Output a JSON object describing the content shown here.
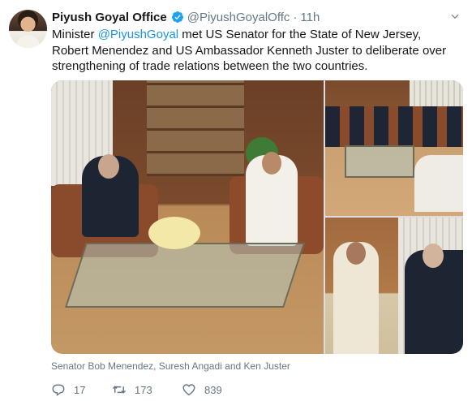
{
  "tweet": {
    "author_name": "Piyush Goyal Office",
    "handle": "@PiyushGoyalOffc",
    "separator": "·",
    "time": "11h",
    "text_before": "Minister ",
    "mention": "@PiyushGoyal",
    "text_after": " met US Senator for the State of New Jersey, Robert Menendez and US Ambassador Kenneth Juster to deliberate over strengthening of trade relations between the two countries.",
    "caption": "Senator Bob Menendez, Suresh Angadi and Ken Juster",
    "stats": {
      "replies": "17",
      "retweets": "173",
      "likes": "839"
    }
  },
  "icons": {
    "verified": "verified-badge-icon",
    "caret": "chevron-down-icon",
    "reply": "reply-icon",
    "retweet": "retweet-icon",
    "like": "heart-icon"
  },
  "colors": {
    "link": "#1b95e0",
    "secondary_text": "#657786",
    "verified": "#1da1f2"
  }
}
